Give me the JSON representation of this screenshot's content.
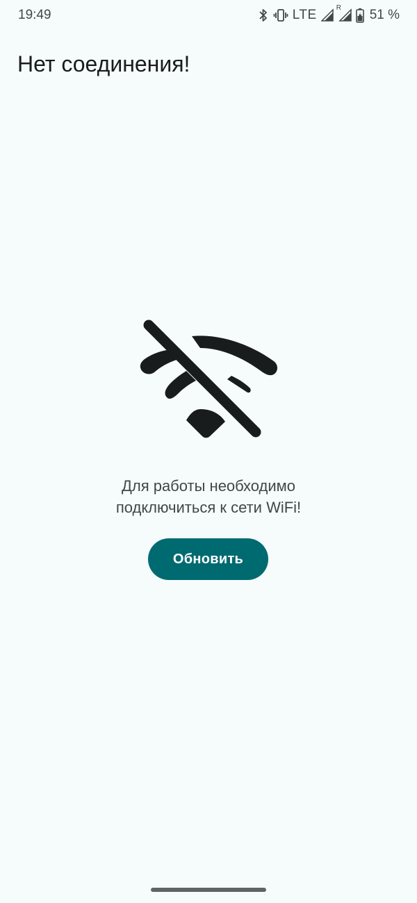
{
  "status_bar": {
    "time": "19:49",
    "network": "LTE",
    "roaming_indicator": "R",
    "battery_percent": "51 %",
    "icons": [
      "bluetooth-icon",
      "vibrate-icon",
      "signal-icon",
      "signal-roaming-icon",
      "battery-charging-icon"
    ]
  },
  "header": {
    "title": "Нет соединения!"
  },
  "main": {
    "icon": "wifi-off-icon",
    "message_line1": "Для работы необходимо",
    "message_line2": "подключиться к сети WiFi!",
    "refresh_button_label": "Обновить"
  },
  "colors": {
    "background": "#f6fbfb",
    "primary": "#006a71",
    "on_primary": "#ffffff",
    "text": "#191c1c",
    "secondary_text": "#3f4848"
  }
}
